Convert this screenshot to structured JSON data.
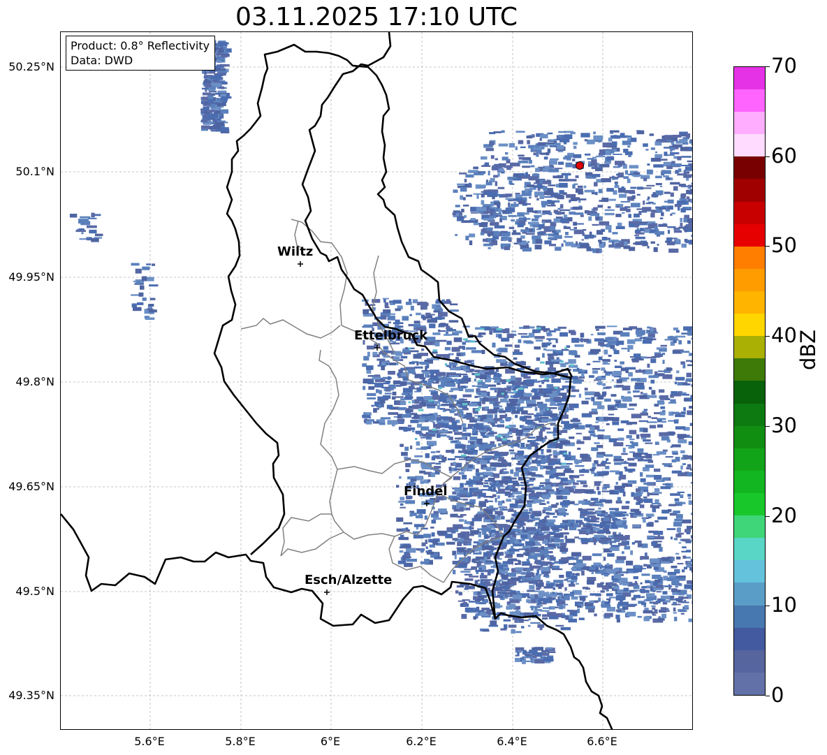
{
  "title": "03.11.2025 17:10 UTC",
  "info": {
    "product": "Product: 0.8° Reflectivity",
    "data_source": "Data: DWD"
  },
  "lat_ticks": [
    "50.25°N",
    "50.1°N",
    "49.95°N",
    "49.8°N",
    "49.65°N",
    "49.5°N",
    "49.35°N"
  ],
  "lon_ticks": [
    "5.6°E",
    "5.8°E",
    "6°E",
    "6.2°E",
    "6.4°E",
    "6.6°E"
  ],
  "cities": [
    "Wiltz",
    "Ettelbruck",
    "Findel",
    "Esch/Alzette"
  ],
  "colorbar": {
    "label": "dBZ",
    "ticks": [
      "0",
      "10",
      "20",
      "30",
      "40",
      "50",
      "60",
      "70"
    ],
    "colors": [
      "#6271a8",
      "#56659e",
      "#435aa0",
      "#4878b0",
      "#5a9ec8",
      "#64c2dc",
      "#5ad6c6",
      "#3ed678",
      "#18c82a",
      "#12b620",
      "#12a418",
      "#108e12",
      "#0c7a10",
      "#08620a",
      "#3e7a08",
      "#aab004",
      "#ffd600",
      "#ffb400",
      "#ff9c00",
      "#ff7e00",
      "#e60000",
      "#c80000",
      "#a00000",
      "#780000",
      "#ffdcff",
      "#ffaeff",
      "#ff64ff",
      "#e632e6"
    ]
  },
  "station_marker": "red-dot"
}
